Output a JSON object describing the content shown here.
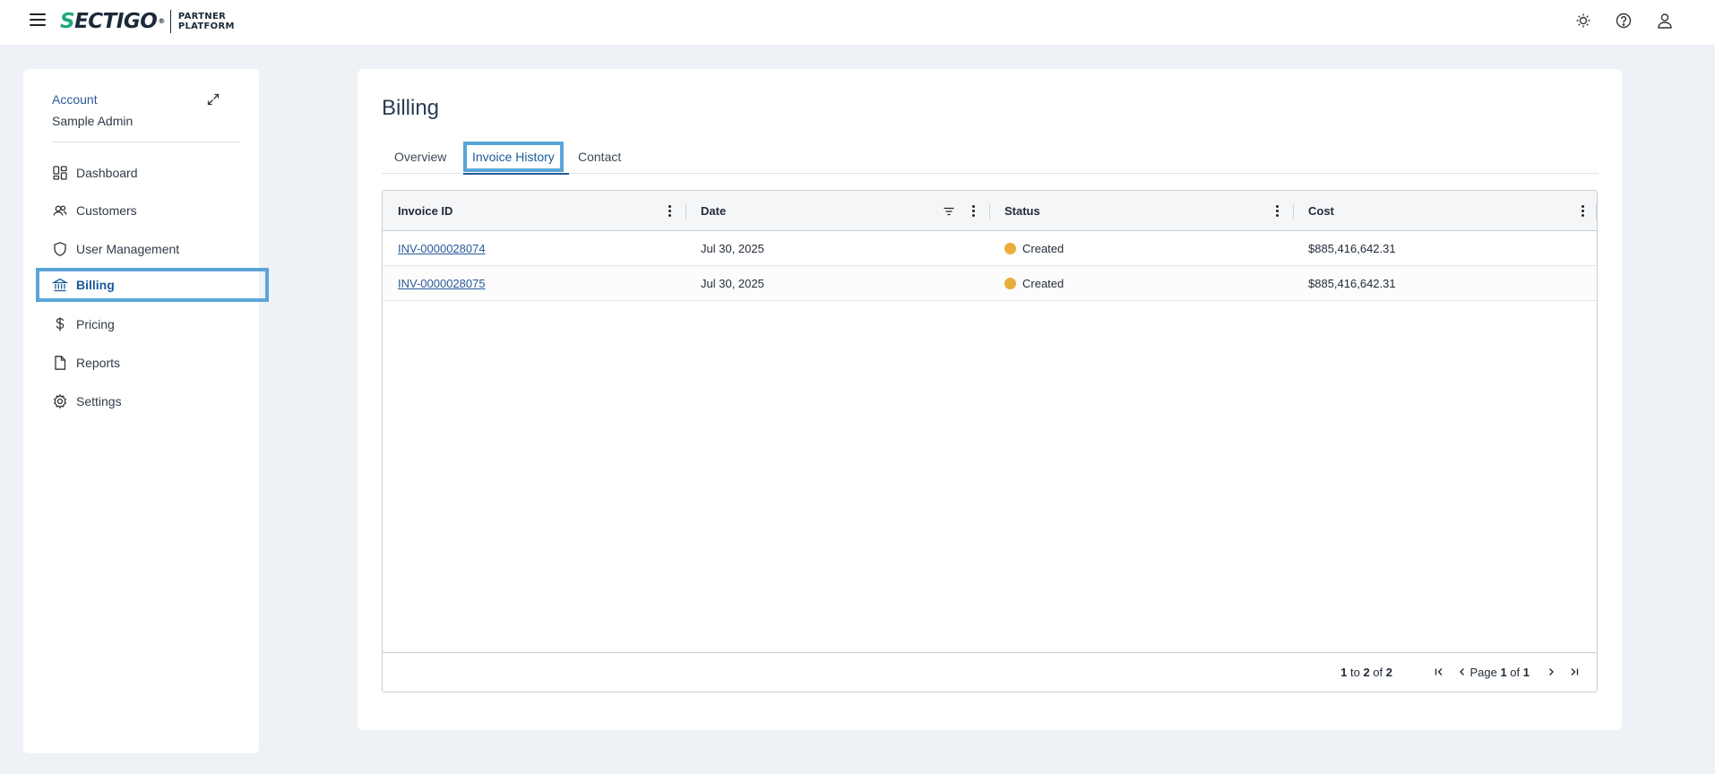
{
  "brand": {
    "logo_initial": "S",
    "logo_rest": "ECTIGO",
    "logo_mark": "®",
    "sub_line1": "PARTNER",
    "sub_line2": "PLATFORM"
  },
  "topbar": {
    "icons": [
      "theme-toggle-icon",
      "help-icon",
      "user-account-icon"
    ]
  },
  "sidebar": {
    "account_label": "Account",
    "account_name": "Sample Admin",
    "items": [
      {
        "label": "Dashboard",
        "icon": "dashboard-icon"
      },
      {
        "label": "Customers",
        "icon": "customers-icon"
      },
      {
        "label": "User Management",
        "icon": "shield-icon"
      },
      {
        "label": "Billing",
        "icon": "bank-icon",
        "active": true
      },
      {
        "label": "Pricing",
        "icon": "dollar-icon"
      },
      {
        "label": "Reports",
        "icon": "document-icon"
      },
      {
        "label": "Settings",
        "icon": "gear-icon"
      }
    ]
  },
  "main": {
    "title": "Billing",
    "tabs": [
      {
        "label": "Overview"
      },
      {
        "label": "Invoice History",
        "active": true
      },
      {
        "label": "Contact"
      }
    ]
  },
  "grid": {
    "columns": [
      "Invoice ID",
      "Date",
      "Status",
      "Cost"
    ],
    "rows": [
      {
        "invoice_id": "INV-0000028074",
        "date": "Jul 30, 2025",
        "status": "Created",
        "cost": "$885,416,642.31"
      },
      {
        "invoice_id": "INV-0000028075",
        "date": "Jul 30, 2025",
        "status": "Created",
        "cost": "$885,416,642.31"
      }
    ],
    "status_color": "#e9ad3c",
    "pagination": {
      "from": "1",
      "to_word": "to",
      "to": "2",
      "of_word": "of",
      "total": "2",
      "page_word": "Page",
      "page": "1",
      "page_of_word": "of",
      "page_total": "1"
    }
  },
  "colors": {
    "accent": "#1b5a9a",
    "highlight_border": "#5aa5d8",
    "brand_green": "#1fa97a",
    "background": "#eef1f5"
  }
}
